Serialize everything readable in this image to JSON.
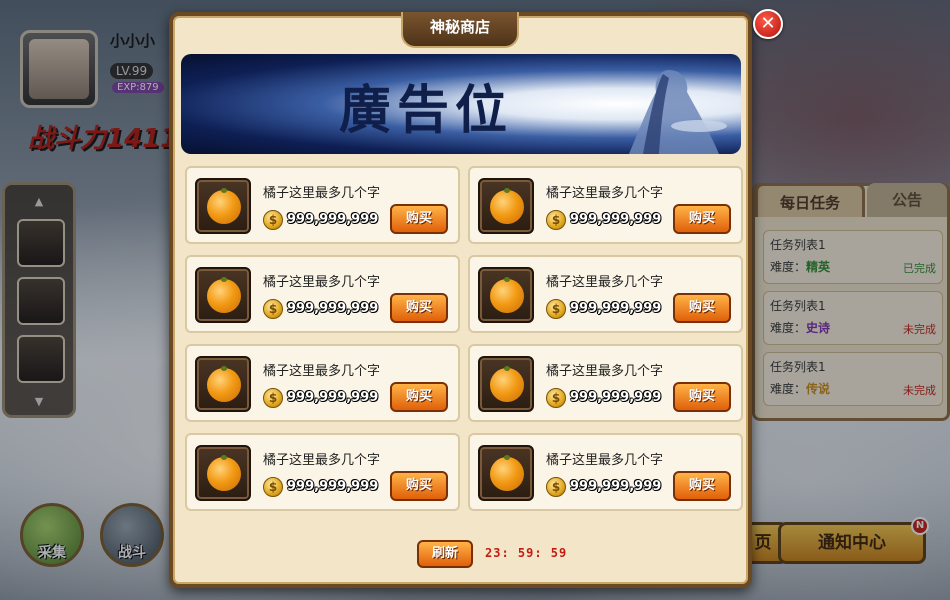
{
  "background": {
    "player": {
      "name": "小小小",
      "level": "LV.99",
      "exp": "EXP:879",
      "power": "战斗力1411"
    },
    "bottom_left_buttons": [
      {
        "label": "采集",
        "icon": "money-bag-icon"
      },
      {
        "label": "战斗",
        "icon": "crossed-axes-icon"
      }
    ],
    "task_panel": {
      "tabs": [
        "每日任务",
        "公告"
      ],
      "tasks": [
        {
          "title": "任务列表1",
          "difficulty_label": "难度：",
          "difficulty": "精英",
          "difficulty_color": "#2e8b2e",
          "status": "已完成",
          "status_color": "#2e8b2e"
        },
        {
          "title": "任务列表1",
          "difficulty_label": "难度：",
          "difficulty": "史诗",
          "difficulty_color": "#7b2ea8",
          "status": "未完成",
          "status_color": "#c41c12"
        },
        {
          "title": "任务列表1",
          "difficulty_label": "难度：",
          "difficulty": "传说",
          "difficulty_color": "#c98a10",
          "status": "未完成",
          "status_color": "#c41c12"
        }
      ]
    },
    "bottom_right_buttons": [
      {
        "label": "页"
      },
      {
        "label": "通知中心",
        "badge": "N"
      }
    ]
  },
  "shop": {
    "title": "神秘商店",
    "close_symbol": "✕",
    "banner_text": "廣告位",
    "items": [
      {
        "name": "橘子这里最多几个字",
        "price": "999,999,999",
        "buy_label": "购买",
        "icon": "orange-icon"
      },
      {
        "name": "橘子这里最多几个字",
        "price": "999,999,999",
        "buy_label": "购买",
        "icon": "orange-icon"
      },
      {
        "name": "橘子这里最多几个字",
        "price": "999,999,999",
        "buy_label": "购买",
        "icon": "orange-icon"
      },
      {
        "name": "橘子这里最多几个字",
        "price": "999,999,999",
        "buy_label": "购买",
        "icon": "orange-icon"
      },
      {
        "name": "橘子这里最多几个字",
        "price": "999,999,999",
        "buy_label": "购买",
        "icon": "orange-icon"
      },
      {
        "name": "橘子这里最多几个字",
        "price": "999,999,999",
        "buy_label": "购买",
        "icon": "orange-icon"
      },
      {
        "name": "橘子这里最多几个字",
        "price": "999,999,999",
        "buy_label": "购买",
        "icon": "orange-icon"
      },
      {
        "name": "橘子这里最多几个字",
        "price": "999,999,999",
        "buy_label": "购买",
        "icon": "orange-icon"
      }
    ],
    "coin_symbol": "$",
    "refresh_label": "刷新",
    "timer": "23: 59: 59"
  }
}
